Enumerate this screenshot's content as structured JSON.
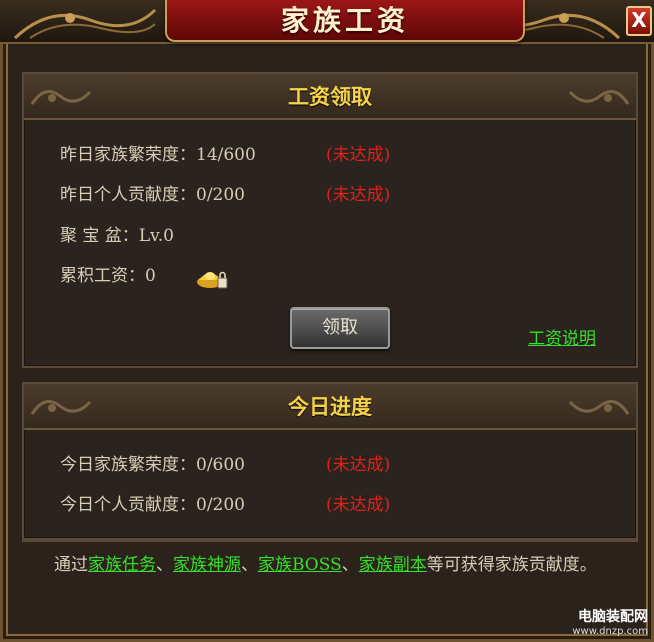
{
  "window": {
    "title": "家族工资",
    "close_label": "X"
  },
  "salary_panel": {
    "title": "工资领取",
    "rows": [
      {
        "label": "昨日家族繁荣度：",
        "value": "14/600",
        "status": "(未达成)"
      },
      {
        "label": "昨日个人贡献度：",
        "value": "0/200",
        "status": "(未达成)"
      },
      {
        "label": "聚 宝 盆：",
        "value": "Lv.0"
      },
      {
        "label": "累积工资：",
        "value": "0"
      }
    ],
    "claim_button": "领取",
    "help_link": "工资说明",
    "currency_icon": "gold-ingot-icon"
  },
  "today_panel": {
    "title": "今日进度",
    "rows": [
      {
        "label": "今日家族繁荣度：",
        "value": "0/600",
        "status": "(未达成)"
      },
      {
        "label": "今日个人贡献度：",
        "value": "0/200",
        "status": "(未达成)"
      }
    ]
  },
  "note": {
    "prefix": "通过",
    "link1": "家族任务",
    "sep1": "、",
    "link2": "家族神源",
    "sep2": "、",
    "link3": "家族BOSS",
    "sep3": "、",
    "link4": "家族副本",
    "suffix": "等可获得家族贡献度。"
  },
  "watermark": {
    "line1": "电脑装配网",
    "line2": "www.dnzp.com"
  },
  "colors": {
    "title_gold": "#f7d34a",
    "status_red": "#e0201a",
    "link_green": "#37e02d",
    "title_plate_red": "#9c1717"
  }
}
